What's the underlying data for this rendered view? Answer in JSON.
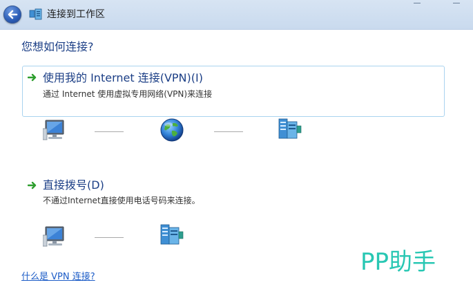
{
  "window": {
    "title": "连接到工作区"
  },
  "heading": "您想如何连接?",
  "options": [
    {
      "title": "使用我的 Internet 连接(VPN)(I)",
      "description": "通过 Internet 使用虚拟专用网络(VPN)来连接",
      "diagram": [
        "computer-icon",
        "globe-icon",
        "server-icon"
      ]
    },
    {
      "title": "直接拨号(D)",
      "description": "不通过Internet直接使用电话号码来连接。",
      "diagram": [
        "computer-icon",
        "server-icon"
      ]
    }
  ],
  "help_link": "什么是 VPN 连接?",
  "watermark": "PP助手",
  "colors": {
    "heading": "#1c3f86",
    "link": "#1c5cc7",
    "arrow": "#2e9e2e",
    "watermark": "#28c7b3",
    "selection_border": "#a9d3ef"
  }
}
